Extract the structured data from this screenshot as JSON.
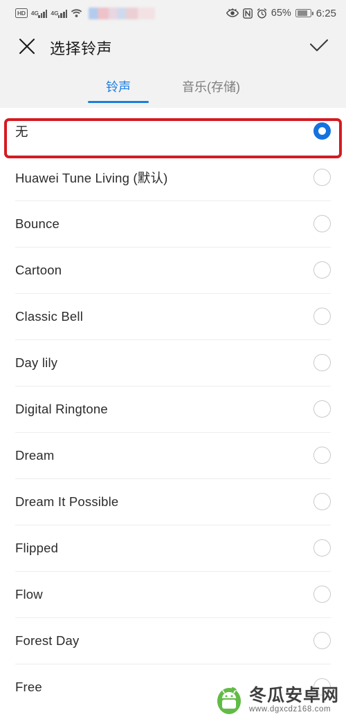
{
  "status_bar": {
    "hd_label": "HD",
    "network_1": "4G",
    "network_2": "4G",
    "wifi_icon": "wifi-icon",
    "carrier_blurred": "",
    "eye_icon": "eye-comfort-icon",
    "nfc_icon": "nfc-icon",
    "alarm_icon": "alarm-clock-icon",
    "battery_percent": "65%",
    "battery_icon": "battery-charging-icon",
    "time": "6:25"
  },
  "app_bar": {
    "close_icon": "close-icon",
    "title": "选择铃声",
    "confirm_icon": "check-icon"
  },
  "tabs": [
    {
      "label": "铃声",
      "active": true
    },
    {
      "label": "音乐(存储)",
      "active": false
    }
  ],
  "colors": {
    "accent": "#1a7de0",
    "radio_selected": "#1472e0",
    "annotation": "#d51b21",
    "header_bg": "#f2f2f2",
    "divider": "#ededed",
    "logo_green": "#62bb46"
  },
  "ringtones": [
    {
      "label": "无",
      "selected": true,
      "highlighted": true
    },
    {
      "label": "Huawei Tune Living (默认)",
      "selected": false,
      "highlighted": false
    },
    {
      "label": "Bounce",
      "selected": false,
      "highlighted": false
    },
    {
      "label": "Cartoon",
      "selected": false,
      "highlighted": false
    },
    {
      "label": "Classic Bell",
      "selected": false,
      "highlighted": false
    },
    {
      "label": "Day lily",
      "selected": false,
      "highlighted": false
    },
    {
      "label": "Digital Ringtone",
      "selected": false,
      "highlighted": false
    },
    {
      "label": "Dream",
      "selected": false,
      "highlighted": false
    },
    {
      "label": "Dream It Possible",
      "selected": false,
      "highlighted": false
    },
    {
      "label": "Flipped",
      "selected": false,
      "highlighted": false
    },
    {
      "label": "Flow",
      "selected": false,
      "highlighted": false
    },
    {
      "label": "Forest Day",
      "selected": false,
      "highlighted": false
    },
    {
      "label": "Free",
      "selected": false,
      "highlighted": false
    }
  ],
  "watermark": {
    "site_name": "冬瓜安卓网",
    "url": "www.dgxcdz168.com",
    "logo_icon": "winter-melon-android-logo"
  }
}
